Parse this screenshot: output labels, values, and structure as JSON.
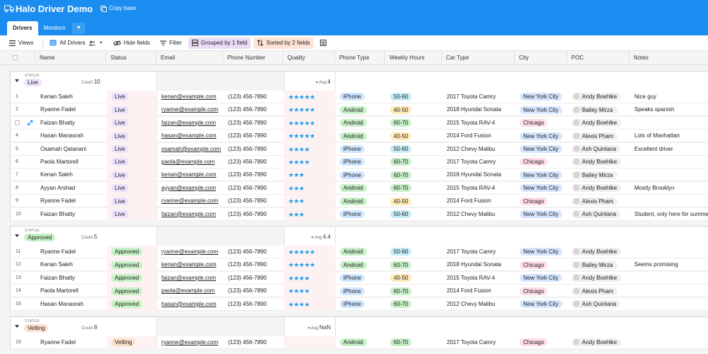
{
  "app": {
    "base_name": "Halo Driver Demo",
    "copy_base_label": "Copy base",
    "tabs": [
      {
        "label": "Drivers",
        "active": true
      },
      {
        "label": "Monitors",
        "active": false
      }
    ]
  },
  "toolbar": {
    "views_label": "Views",
    "view_name": "All Drivers",
    "hide_fields_label": "Hide fields",
    "filter_label": "Filter",
    "grouped_label": "Grouped by 1 field",
    "sorted_label": "Sorted by 2 fields"
  },
  "columns": [
    "Name",
    "Status",
    "Email",
    "Phone Number",
    "Quality",
    "Phone Type",
    "Weekly Hours",
    "Car Type",
    "City",
    "POC",
    "Notes"
  ],
  "groups": [
    {
      "label": "STATUS",
      "status": "Live",
      "status_class": "p-live",
      "count_label": "Count",
      "count": "10",
      "avg_label": "Avg",
      "avg": "4",
      "rows": [
        {
          "n": "1",
          "name": "Kenan Saleh",
          "status": "Live",
          "email": "kenan@example.com",
          "phone": "(123) 456-7890",
          "quality": 5,
          "phone_type": "iPhone",
          "hours": "50-60",
          "car": "2017 Toyota Camry",
          "city": "New York City",
          "poc": "Andy Boehlke",
          "notes": "Nice guy"
        },
        {
          "n": "2",
          "name": "Ryanne Fadel",
          "status": "Live",
          "email": "ryanne@example.com",
          "phone": "(123) 456-7890",
          "quality": 5,
          "phone_type": "Android",
          "hours": "40-50",
          "car": "2018 Hyundai Sonata",
          "city": "New York City",
          "poc": "Bailey Mirza",
          "notes": "Speaks spanish"
        },
        {
          "n": "",
          "name": "Faizan Bhatty",
          "status": "Live",
          "email": "faizan@example.com",
          "phone": "(123) 456-7890",
          "quality": 5,
          "phone_type": "Android",
          "hours": "60-70",
          "car": "2015 Toyota RAV-4",
          "city": "Chicago",
          "poc": "Andy Boehlke",
          "notes": "",
          "hover": true
        },
        {
          "n": "4",
          "name": "Hasan Manasrah",
          "status": "Live",
          "email": "hasan@example.com",
          "phone": "(123) 456-7890",
          "quality": 5,
          "phone_type": "Android",
          "hours": "40-50",
          "car": "2014 Ford Fusion",
          "city": "New York City",
          "poc": "Alexis Pham",
          "notes": "Lots of Manhattan"
        },
        {
          "n": "5",
          "name": "Osamah Qatanani",
          "status": "Live",
          "email": "osamah@example.com",
          "phone": "(123) 456-7890",
          "quality": 4,
          "phone_type": "iPhone",
          "hours": "50-60",
          "car": "2012 Chevy Malibu",
          "city": "New York City",
          "poc": "Ash Quintana",
          "notes": "Excellent driver"
        },
        {
          "n": "6",
          "name": "Paola Martorell",
          "status": "Live",
          "email": "paola@example.com",
          "phone": "(123) 456-7890",
          "quality": 4,
          "phone_type": "iPhone",
          "hours": "60-70",
          "car": "2017 Toyota Camry",
          "city": "Chicago",
          "poc": "Andy Boehlke",
          "notes": ""
        },
        {
          "n": "7",
          "name": "Kenan Saleh",
          "status": "Live",
          "email": "kenan@example.com",
          "phone": "(123) 456-7890",
          "quality": 3,
          "phone_type": "iPhone",
          "hours": "60-70",
          "car": "2018 Hyundai Sonata",
          "city": "New York City",
          "poc": "Bailey Mirza",
          "notes": ""
        },
        {
          "n": "8",
          "name": "Ayyan Arshad",
          "status": "Live",
          "email": "ayyan@example.com",
          "phone": "(123) 456-7890",
          "quality": 3,
          "phone_type": "Android",
          "hours": "60-70",
          "car": "2015 Toyota RAV-4",
          "city": "New York City",
          "poc": "Andy Boehlke",
          "notes": "Mostly Brooklyn"
        },
        {
          "n": "9",
          "name": "Ryanne Fadel",
          "status": "Live",
          "email": "ryanne@example.com",
          "phone": "(123) 456-7890",
          "quality": 3,
          "phone_type": "Android",
          "hours": "40-50",
          "car": "2014 Ford Fusion",
          "city": "Chicago",
          "poc": "Alexis Pham",
          "notes": ""
        },
        {
          "n": "10",
          "name": "Faizan Bhatty",
          "status": "Live",
          "email": "faizan@example.com",
          "phone": "(123) 456-7890",
          "quality": 3,
          "phone_type": "iPhone",
          "hours": "50-60",
          "car": "2012 Chevy Malibu",
          "city": "New York City",
          "poc": "Ash Quintana",
          "notes": "Student, only here for summer"
        }
      ]
    },
    {
      "label": "STATUS",
      "status": "Approved",
      "status_class": "p-approved",
      "count_label": "Count",
      "count": "5",
      "avg_label": "Avg",
      "avg": "4.4",
      "rows": [
        {
          "n": "11",
          "name": "Ryanne Fadel",
          "status": "Approved",
          "email": "ryanne@example.com",
          "phone": "(123) 456-7890",
          "quality": 5,
          "phone_type": "Android",
          "hours": "50-60",
          "car": "2017 Toyota Camry",
          "city": "New York City",
          "poc": "Andy Boehlke",
          "notes": ""
        },
        {
          "n": "12",
          "name": "Kenan Saleh",
          "status": "Approved",
          "email": "kenan@example.com",
          "phone": "(123) 456-7890",
          "quality": 5,
          "phone_type": "Android",
          "hours": "60-70",
          "car": "2018 Hyundai Sonata",
          "city": "Chicago",
          "poc": "Bailey Mirza",
          "notes": "Seems promising"
        },
        {
          "n": "13",
          "name": "Faizan Bhatty",
          "status": "Approved",
          "email": "faizan@example.com",
          "phone": "(123) 456-7890",
          "quality": 4,
          "phone_type": "iPhone",
          "hours": "40-50",
          "car": "2015 Toyota RAV-4",
          "city": "New York City",
          "poc": "Andy Boehlke",
          "notes": ""
        },
        {
          "n": "14",
          "name": "Paola Martorell",
          "status": "Approved",
          "email": "paola@example.com",
          "phone": "(123) 456-7890",
          "quality": 4,
          "phone_type": "iPhone",
          "hours": "60-70",
          "car": "2014 Ford Fusion",
          "city": "Chicago",
          "poc": "Alexis Pham",
          "notes": ""
        },
        {
          "n": "15",
          "name": "Hasan Manasrah",
          "status": "Approved",
          "email": "hasan@example.com",
          "phone": "(123) 456-7890",
          "quality": 4,
          "phone_type": "iPhone",
          "hours": "60-70",
          "car": "2012 Chevy Malibu",
          "city": "New York City",
          "poc": "Ash Quintana",
          "notes": ""
        }
      ]
    },
    {
      "label": "STATUS",
      "status": "Vetting",
      "status_class": "p-vetting",
      "count_label": "Count",
      "count": "8",
      "avg_label": "Avg",
      "avg": "NaN",
      "rows": [
        {
          "n": "16",
          "name": "Ryanne Fadel",
          "status": "Vetting",
          "email": "ryanne@example.com",
          "phone": "(123) 456-7890",
          "quality": 0,
          "phone_type": "Android",
          "hours": "60-70",
          "car": "2017 Toyota Camry",
          "city": "Chicago",
          "poc": "Andy Boehlke",
          "notes": ""
        }
      ]
    }
  ],
  "colors": {
    "appbar": "#1b8df0",
    "star": "#1a9cf0",
    "live": "#ede2fe",
    "approved": "#c7f2c6",
    "vetting": "#fde0cc"
  }
}
